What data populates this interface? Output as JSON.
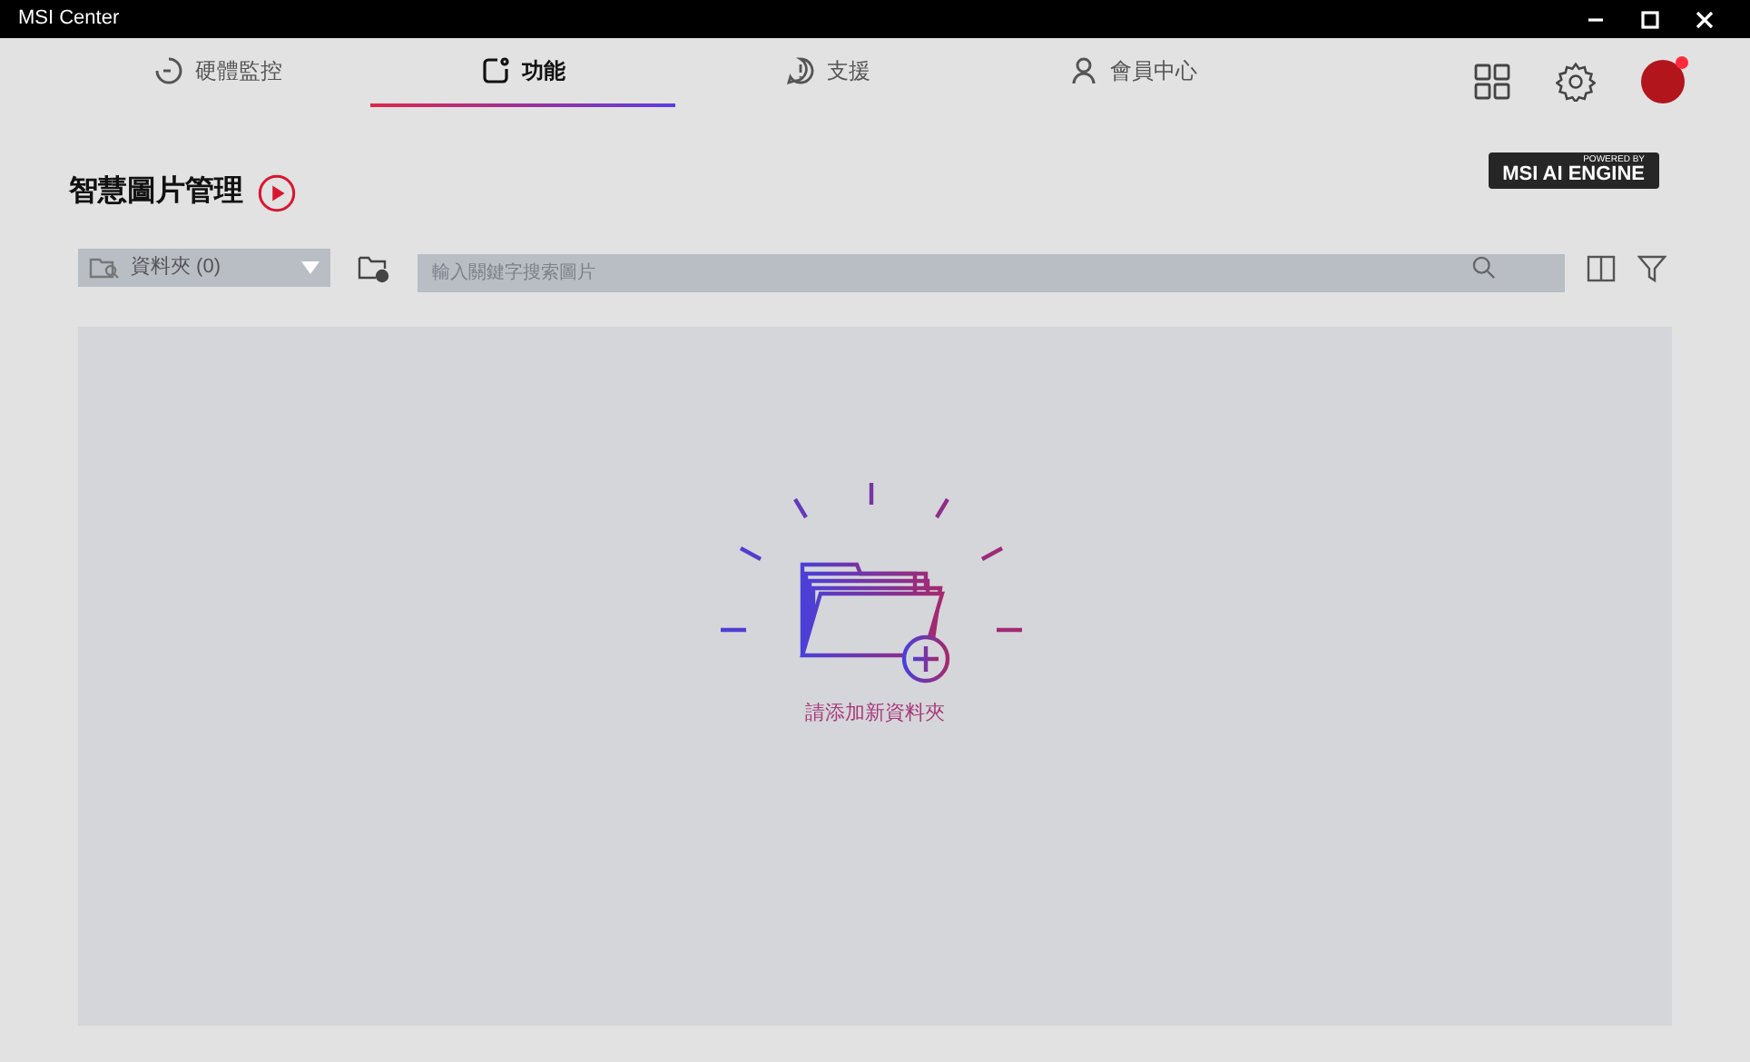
{
  "window": {
    "title": "MSI Center"
  },
  "tabs": [
    {
      "label": "硬體監控",
      "kind": "gauge",
      "selected": false
    },
    {
      "label": "功能",
      "kind": "feature",
      "selected": true
    },
    {
      "label": "支援",
      "kind": "support",
      "selected": false
    },
    {
      "label": "會員中心",
      "kind": "user",
      "selected": false
    }
  ],
  "notification": {
    "on": true
  },
  "page": {
    "title": "智慧圖片管理",
    "badge_small": "POWERED BY",
    "badge_large": "MSI AI ENGINE"
  },
  "toolbar": {
    "folder_select": "資料夾 (0)",
    "search": {
      "placeholder": "輸入關鍵字搜索圖片"
    }
  },
  "empty_state": {
    "message": "請添加新資料夾"
  }
}
